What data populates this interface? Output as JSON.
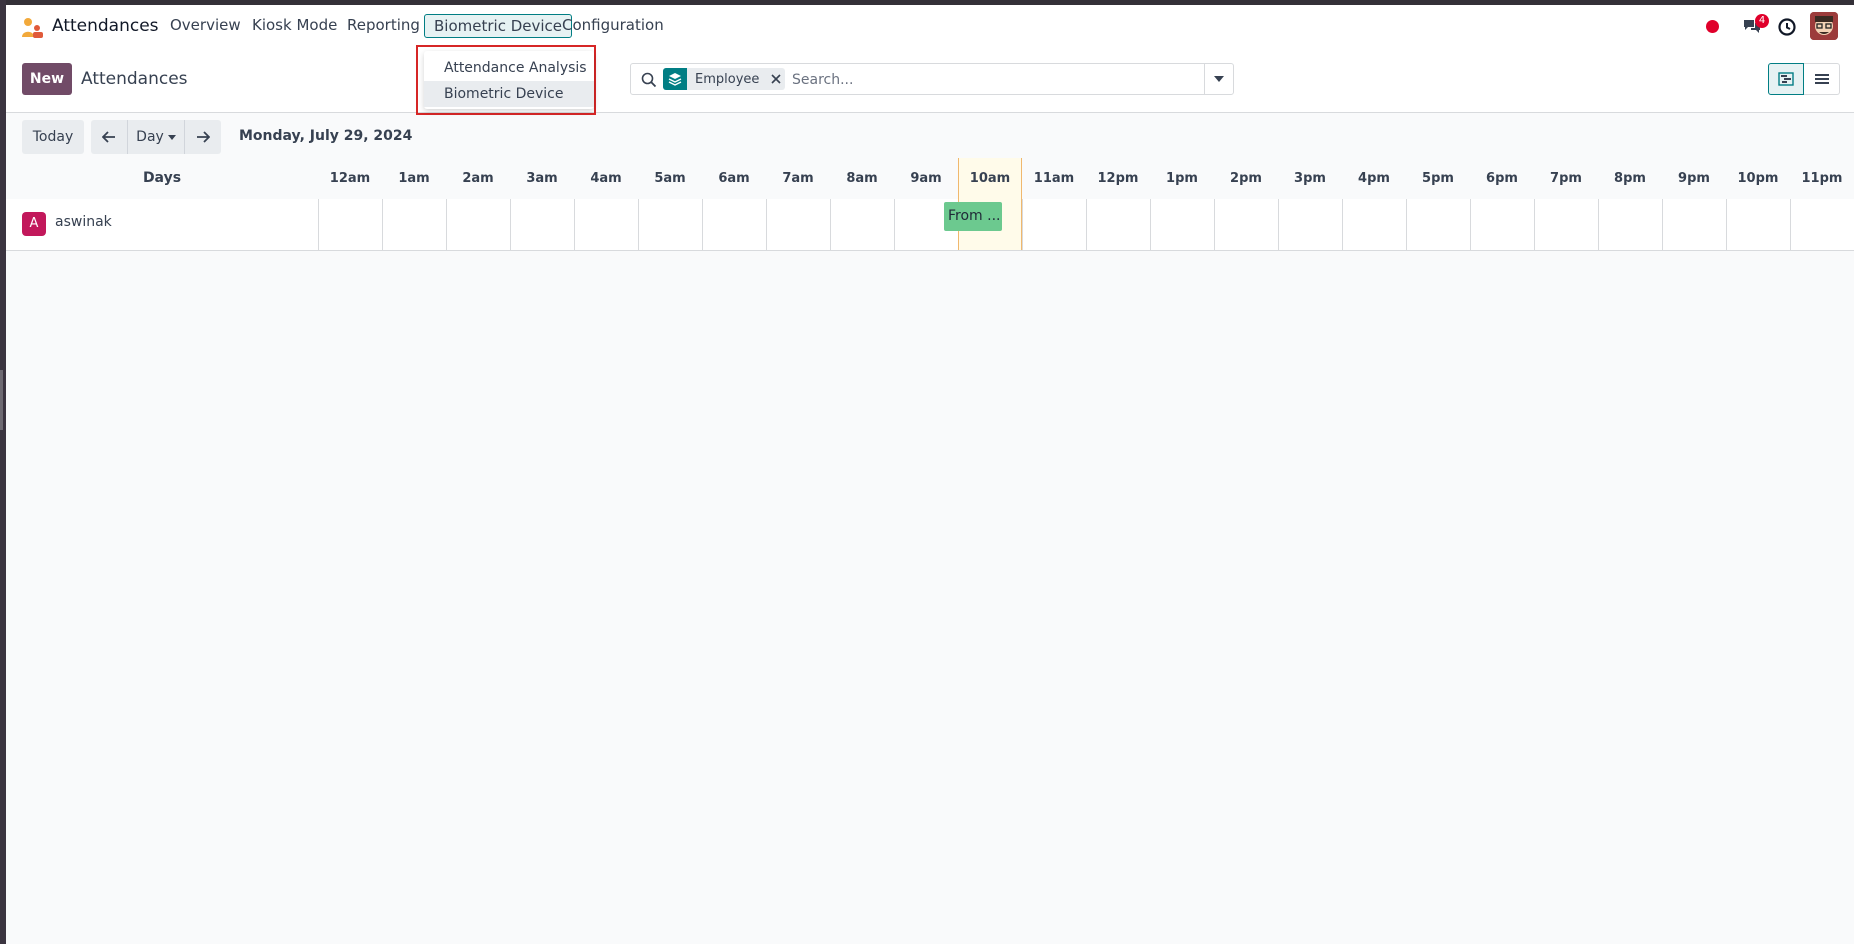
{
  "navbar": {
    "app_name": "Attendances",
    "menu": [
      {
        "label": "Overview"
      },
      {
        "label": "Kiosk Mode"
      },
      {
        "label": "Reporting"
      },
      {
        "label": "Biometric Device"
      },
      {
        "label": "Configuration"
      }
    ],
    "notification_count": "4",
    "rec_color": "#e0002b"
  },
  "dropdown": {
    "items": [
      {
        "label": "Attendance Analysis"
      },
      {
        "label": "Biometric Device"
      }
    ]
  },
  "control_panel": {
    "new_label": "New",
    "title": "Attendances",
    "search": {
      "facet_label": "Employee",
      "placeholder": "Search..."
    }
  },
  "gantt": {
    "today_label": "Today",
    "scale_label": "Day",
    "date_label": "Monday, July 29, 2024",
    "row_header_title": "Days",
    "hours": [
      "12am",
      "1am",
      "2am",
      "3am",
      "4am",
      "5am",
      "6am",
      "7am",
      "8am",
      "9am",
      "10am",
      "11am",
      "12pm",
      "1pm",
      "2pm",
      "3pm",
      "4pm",
      "5pm",
      "6pm",
      "7pm",
      "8pm",
      "9pm",
      "10pm",
      "11pm"
    ],
    "rows": [
      {
        "avatar_letter": "A",
        "name": "aswinak",
        "pill_text": "From ..."
      }
    ]
  },
  "colors": {
    "brand": "#714b67",
    "accent": "#017e84",
    "pill": "#6cc98f",
    "avatar": "#c2185b"
  }
}
